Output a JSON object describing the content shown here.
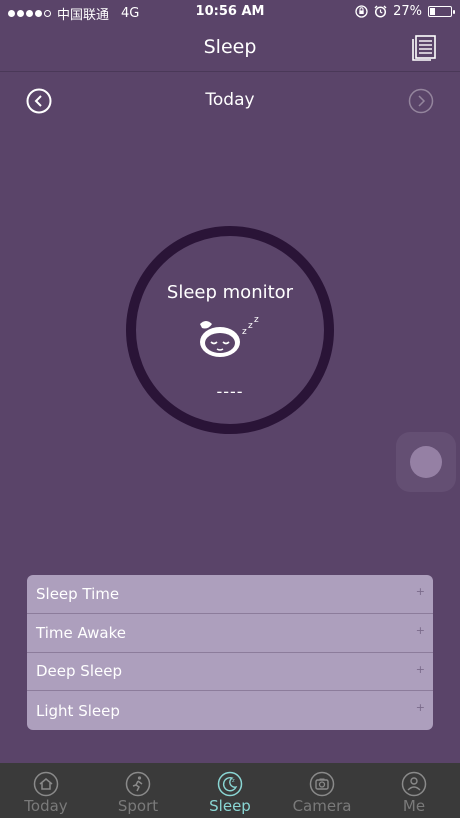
{
  "status_bar": {
    "carrier": "中国联通",
    "network": "4G",
    "time": "10:56 AM",
    "battery": "27%",
    "battery_level": 0.27
  },
  "nav": {
    "title": "Sleep"
  },
  "date_nav": {
    "label": "Today"
  },
  "monitor": {
    "title": "Sleep monitor",
    "value": "----"
  },
  "stats": [
    {
      "label": "Sleep Time"
    },
    {
      "label": "Time Awake"
    },
    {
      "label": "Deep Sleep"
    },
    {
      "label": "Light Sleep"
    }
  ],
  "tabs": [
    {
      "label": "Today",
      "icon": "home-icon",
      "active": false
    },
    {
      "label": "Sport",
      "icon": "runner-icon",
      "active": false
    },
    {
      "label": "Sleep",
      "icon": "moon-icon",
      "active": true
    },
    {
      "label": "Camera",
      "icon": "camera-icon",
      "active": false
    },
    {
      "label": "Me",
      "icon": "person-icon",
      "active": false
    }
  ],
  "colors": {
    "background": "#5a4469",
    "ring": "#2a1437",
    "list_bg": "#ad9fbd",
    "tab_bar": "#3a3a3a",
    "tab_active": "#8ad6d4",
    "tab_inactive": "#7a7a7a"
  }
}
